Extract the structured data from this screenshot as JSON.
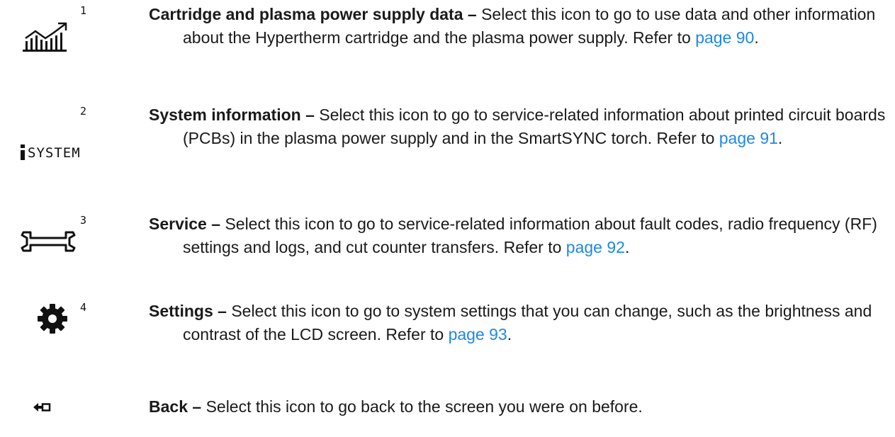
{
  "entries": [
    {
      "number": "1",
      "icon": "chart-trend-icon",
      "term": "Cartridge and plasma power supply data",
      "dash": "–",
      "text_before": "Select this icon to go to use data and other information about the Hypertherm cartridge and the plasma power supply. Refer to",
      "link": "page 90",
      "text_after": "."
    },
    {
      "number": "2",
      "icon": "system-info-icon",
      "icon_text": "SYSTEM",
      "term": "System information",
      "dash": "–",
      "text_before": "Select this icon to go to service-related information about printed circuit boards (PCBs) in the plasma power supply and in the SmartSYNC torch. Refer to",
      "link": "page 91",
      "text_after": "."
    },
    {
      "number": "3",
      "icon": "wrench-icon",
      "term": "Service",
      "dash": "–",
      "text_before": "Select this icon to go to service-related information about fault codes, radio frequency (RF) settings and logs, and cut counter transfers. Refer to",
      "link": "page 92",
      "text_after": "."
    },
    {
      "number": "4",
      "icon": "gear-icon",
      "term": "Settings",
      "dash": "–",
      "text_before": "Select this icon to go to system settings that you can change, such as the brightness and contrast of the LCD screen. Refer to",
      "link": "page 93",
      "text_after": "."
    },
    {
      "number": "",
      "icon": "back-arrow-icon",
      "term": "Back",
      "dash": "–",
      "text_before": "Select this icon to go back to the screen you were on before.",
      "link": "",
      "text_after": ""
    }
  ]
}
